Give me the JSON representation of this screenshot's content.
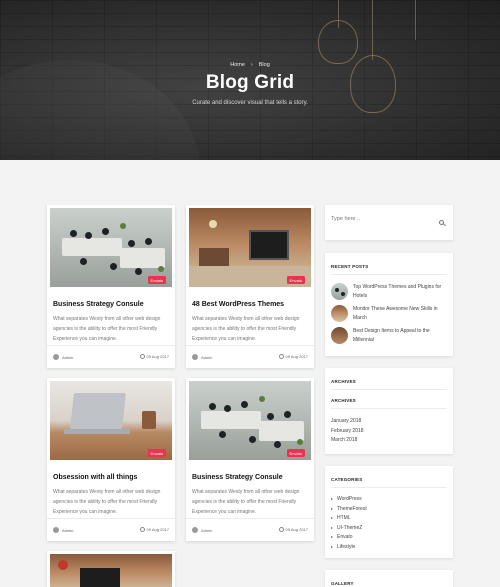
{
  "hero": {
    "breadcrumb": {
      "home": "Home",
      "separator": "›",
      "current": "Blog"
    },
    "title": "Blog Grid",
    "subtitle": "Curate and discover visual that tells a story."
  },
  "posts": [
    {
      "badge": "Envato",
      "title": "Business Strategy Consule",
      "excerpt": "What separates Westy from all other web design agencies is the ability to offer the most Friendly Experience you can imagine.",
      "author": "Admin",
      "date": "09 Aug 2017",
      "image": "office"
    },
    {
      "badge": "Envato",
      "title": "48 Best WordPress Themes",
      "excerpt": "What separates Westy from all other web design agencies is the ability to offer the most Friendly Experience you can imagine.",
      "author": "Admin",
      "date": "09 Aug 2017",
      "image": "cafe"
    },
    {
      "badge": "Envato",
      "title": "Obsession with all things",
      "excerpt": "What separates Westy from all other web design agencies is the ability to offer the most Friendly Experience you can imagine.",
      "author": "Admin",
      "date": "09 Aug 2017",
      "image": "laptop"
    },
    {
      "badge": "Envato",
      "title": "Business Strategy Consule",
      "excerpt": "What separates Westy from all other web design agencies is the ability to offer the most Friendly Experience you can imagine.",
      "author": "Admin",
      "date": "09 Aug 2017",
      "image": "office"
    },
    {
      "image": "cafe"
    }
  ],
  "sidebar": {
    "search": {
      "placeholder": "Type here ..",
      "icon": "search-icon"
    },
    "recent_posts": {
      "title": "RECENT POSTS",
      "items": [
        {
          "text": "Top WordPress Themes and Plugins for Hotels"
        },
        {
          "text": "Monitor These Awesome New Skills in March"
        },
        {
          "text": "Best Design Items to Appeal to the Millennial"
        }
      ]
    },
    "archives_outer_title": "ARCHIVES",
    "archives": {
      "title": "ARCHIVES",
      "items": [
        "January 2018",
        "February 2018",
        "March 2018"
      ]
    },
    "categories": {
      "title": "CATEGORIES",
      "items": [
        "WordPress",
        "ThemeForest",
        "HTML",
        "UI-ThemeZ",
        "Envato",
        "Lifestyle"
      ]
    },
    "gallery_title": "GALLERY"
  },
  "colors": {
    "accent": "#e8344e",
    "hero_bg": "#3a3a3a",
    "page_bg": "#f3f3f3"
  }
}
